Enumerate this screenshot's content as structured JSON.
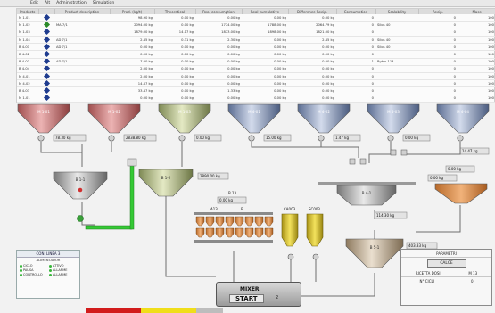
{
  "menu": [
    "Edit",
    "Alt",
    "Administration",
    "Simulation"
  ],
  "table": {
    "headers": [
      "Products",
      "",
      "Product description",
      "Prod. (kg/t)",
      "Theoretical",
      "Real consumption",
      "Real cumulative",
      "Difference Recip.",
      "Consumption",
      "Scalability",
      "Recip.",
      "Mass"
    ],
    "rows": [
      [
        "M 1-01",
        "",
        "",
        "98.90 kg",
        "0.00 kg",
        "0.00 kg",
        "0.00 kg",
        "0.00 kg",
        "0",
        "",
        "0",
        "100"
      ],
      [
        "M 1-02",
        "",
        "MA 7/1",
        "2094.00 kg",
        "0.00 kg",
        "1774.00 kg",
        "1788.00 kg",
        "2064.79 kg",
        "0",
        "Silos 40",
        "0",
        "100"
      ],
      [
        "M 1-03",
        "",
        "",
        "1879.00 kg",
        "14.17 kg",
        "1873.00 kg",
        "1898.00 kg",
        "1821.00 kg",
        "0",
        "",
        "0",
        "100"
      ],
      [
        "M 1-04",
        "",
        "AD 7/1",
        "2.45 kg",
        "0.31 kg",
        "2.30 kg",
        "0.00 kg",
        "2.45 kg",
        "0",
        "Silos 40",
        "0",
        "100"
      ],
      [
        "B 4-01",
        "",
        "AD 7/1",
        "0.00 kg",
        "0.00 kg",
        "0.00 kg",
        "0.00 kg",
        "0.00 kg",
        "0",
        "Silos 40",
        "0",
        "100"
      ],
      [
        "B 4-02",
        "",
        "",
        "0.00 kg",
        "0.00 kg",
        "0.00 kg",
        "0.00 kg",
        "0.00 kg",
        "0",
        "",
        "0",
        "100"
      ],
      [
        "B 4-03",
        "",
        "AD 7/1",
        "7.00 kg",
        "0.00 kg",
        "0.00 kg",
        "0.00 kg",
        "0.00 kg",
        "1",
        "Bytes 114",
        "0",
        "100"
      ],
      [
        "B 4-04",
        "",
        "",
        "2.00 kg",
        "0.00 kg",
        "0.00 kg",
        "0.00 kg",
        "0.00 kg",
        "0",
        "",
        "0",
        "100"
      ],
      [
        "M 4-01",
        "",
        "",
        "2.00 kg",
        "0.00 kg",
        "0.00 kg",
        "0.00 kg",
        "0.00 kg",
        "0",
        "",
        "0",
        "100"
      ],
      [
        "M 4-02",
        "",
        "",
        "14.87 kg",
        "0.00 kg",
        "0.00 kg",
        "0.00 kg",
        "0.00 kg",
        "0",
        "",
        "0",
        "100"
      ],
      [
        "B 4-03",
        "",
        "",
        "33.47 kg",
        "0.00 kg",
        "1.33 kg",
        "0.00 kg",
        "0.00 kg",
        "0",
        "",
        "0",
        "100"
      ],
      [
        "M 1-01",
        "",
        "",
        "0.00 kg",
        "0.00 kg",
        "0.00 kg",
        "0.00 kg",
        "0.00 kg",
        "0",
        "",
        "0",
        "100"
      ]
    ],
    "dot_colors": [
      "#1f3c8f",
      "#2a8a2a",
      "#1f3c8f",
      "#1f3c8f",
      "#1f3c8f",
      "#1f3c8f",
      "#1f3c8f",
      "#1f3c8f",
      "#1f3c8f",
      "#1f3c8f",
      "#1f3c8f",
      "#1f3c8f"
    ]
  },
  "silos": [
    {
      "label": "M 1-01",
      "sub": "",
      "color": "#d98b8b"
    },
    {
      "label": "M 1-02",
      "sub": "",
      "color": "#d98b8b"
    },
    {
      "label": "M 1-03",
      "sub": "",
      "color": "#c9d2a0"
    },
    {
      "label": "M 4-01",
      "sub": "",
      "color": "#a7b6d6"
    },
    {
      "label": "M 4-02",
      "sub": "",
      "color": "#a7b6d6"
    },
    {
      "label": "M 4-03",
      "sub": "",
      "color": "#a7b6d6"
    },
    {
      "label": "M 4-04",
      "sub": "",
      "color": "#a7b6d6"
    }
  ],
  "scale_values": [
    "78.30 kg",
    "2838.80 kg",
    "0.00 kg",
    "15.00 kg",
    "1.47 kg",
    "0.00 kg",
    "14.47 kg"
  ],
  "weigher_labels": {
    "w1": "B 1-1",
    "w2": "B 1-2",
    "w3": "B 3-1",
    "w4": "B 4-1",
    "w5": "B 5-1"
  },
  "weigher_values": {
    "w2": "2890.00 kg",
    "w4": "114.30 kg",
    "w5": "403.83 kg",
    "right1": "0.00 kg",
    "right2": "0.00 kg"
  },
  "dosing": {
    "title": "B 13",
    "value": "0.00 kg",
    "cols": [
      "A13",
      "B"
    ]
  },
  "tanks": [
    {
      "label": "CA003",
      "color": "#d7c22c"
    },
    {
      "label": "SC003",
      "color": "#d7c22c"
    }
  ],
  "connection": {
    "title": "CON. LINEA 3",
    "subtitle": "ALIMENTADOR",
    "items": [
      "CICLO",
      "ATTIVO",
      "PAUSA",
      "ALLARME",
      "CONTROLLO",
      "ALLARME"
    ]
  },
  "info": {
    "header": "PARAMETRI",
    "button": "CALCE",
    "ricetta_label": "RICETTA DOSI",
    "ricetta_value": "M 13",
    "cicli_label": "N° CICLI",
    "cicli_value": "0"
  },
  "mixer": {
    "title": "MIXER",
    "button": "START",
    "number": "2"
  },
  "colors": {
    "conveyor": "#35c935",
    "pipe": "#6e6e6e",
    "valve": "#cfcfcf"
  }
}
